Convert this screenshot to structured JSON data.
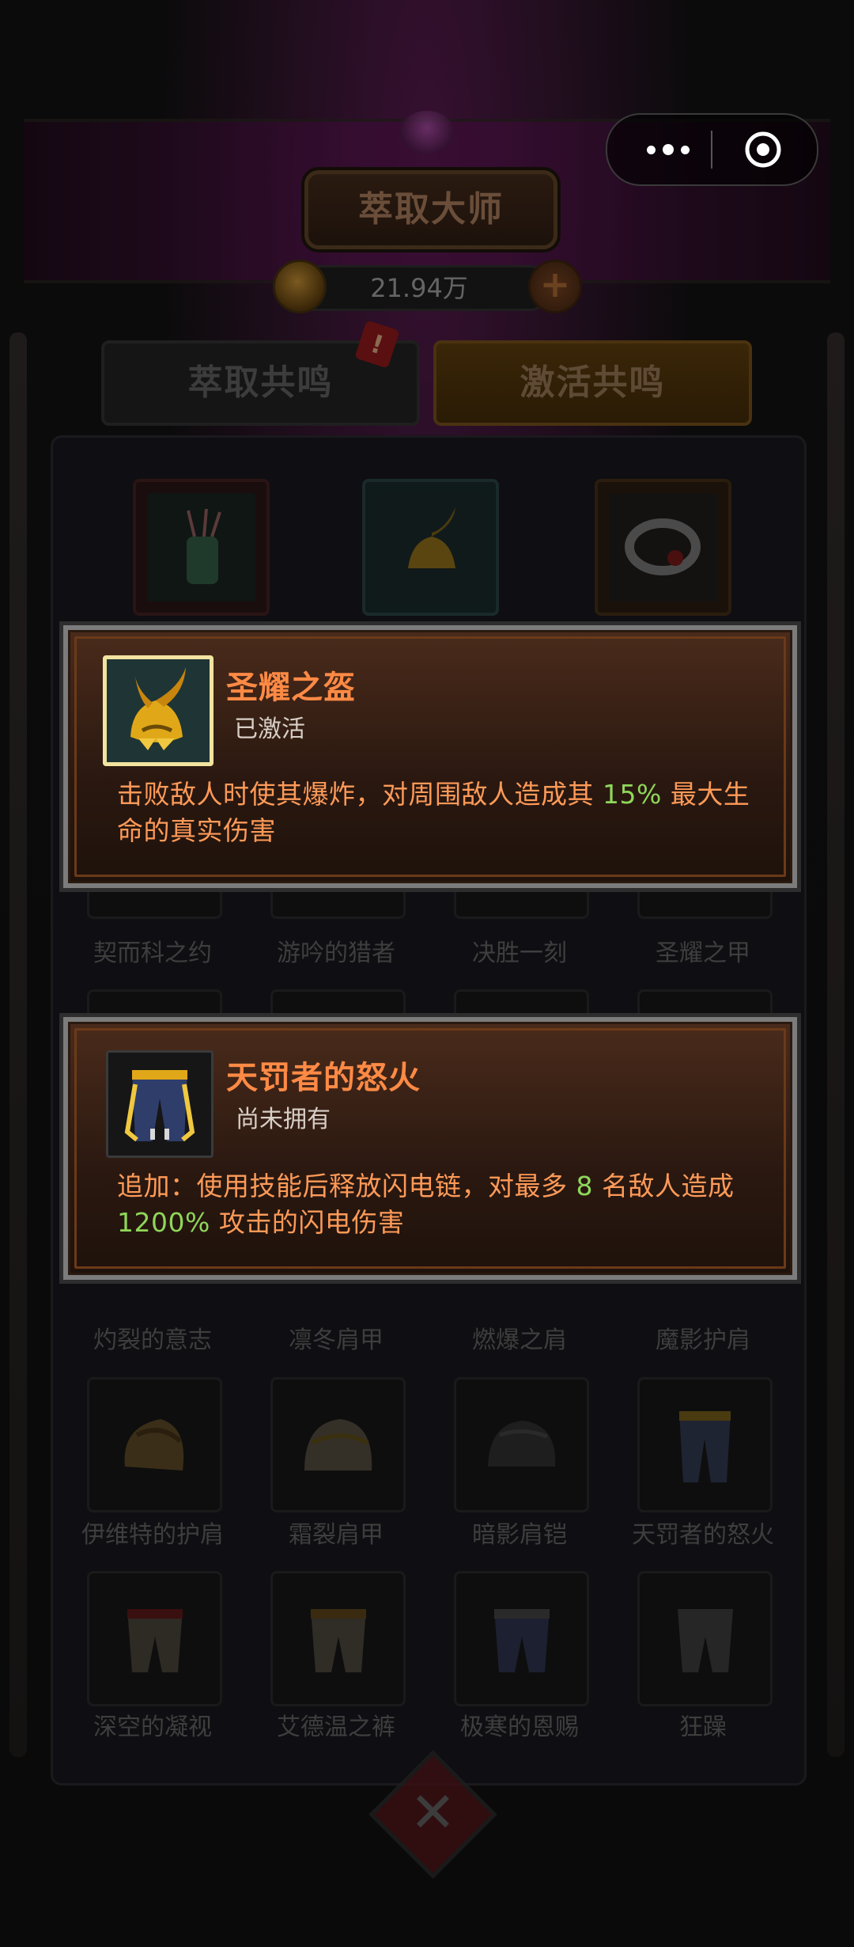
{
  "header": {
    "title": "萃取大师",
    "currency_value": "21.94万"
  },
  "tabs": [
    {
      "label": "萃取共鸣"
    },
    {
      "label": "激活共鸣"
    }
  ],
  "badge": "!",
  "popups": [
    {
      "name": "圣耀之盔",
      "status": "已激活",
      "desc_part1": "击败敌人时使其爆炸，对周围敌人造成其 ",
      "desc_value": "15%",
      "desc_part2": " 最大生命的真实伤害"
    },
    {
      "name": "天罚者的怒火",
      "status": "尚未拥有",
      "desc_part1": "追加：使用技能后释放闪电链，对最多 ",
      "desc_value": "8",
      "desc_part2": " 名敌人造成 ",
      "desc_value2": "1200%",
      "desc_part3": " 攻击的闪电伤害"
    }
  ],
  "items_row1": [
    "契而科之约",
    "游吟的猎者",
    "决胜一刻",
    "圣耀之甲"
  ],
  "items_row2": [
    "灼裂的意志",
    "凛冬肩甲",
    "燃爆之肩",
    "魔影护肩"
  ],
  "items_row3": [
    "伊维特的护肩",
    "霜裂肩甲",
    "暗影肩铠",
    "天罚者的怒火"
  ],
  "items_row4": [
    "深空的凝视",
    "艾德温之裤",
    "极寒的恩赐",
    "狂躁"
  ]
}
